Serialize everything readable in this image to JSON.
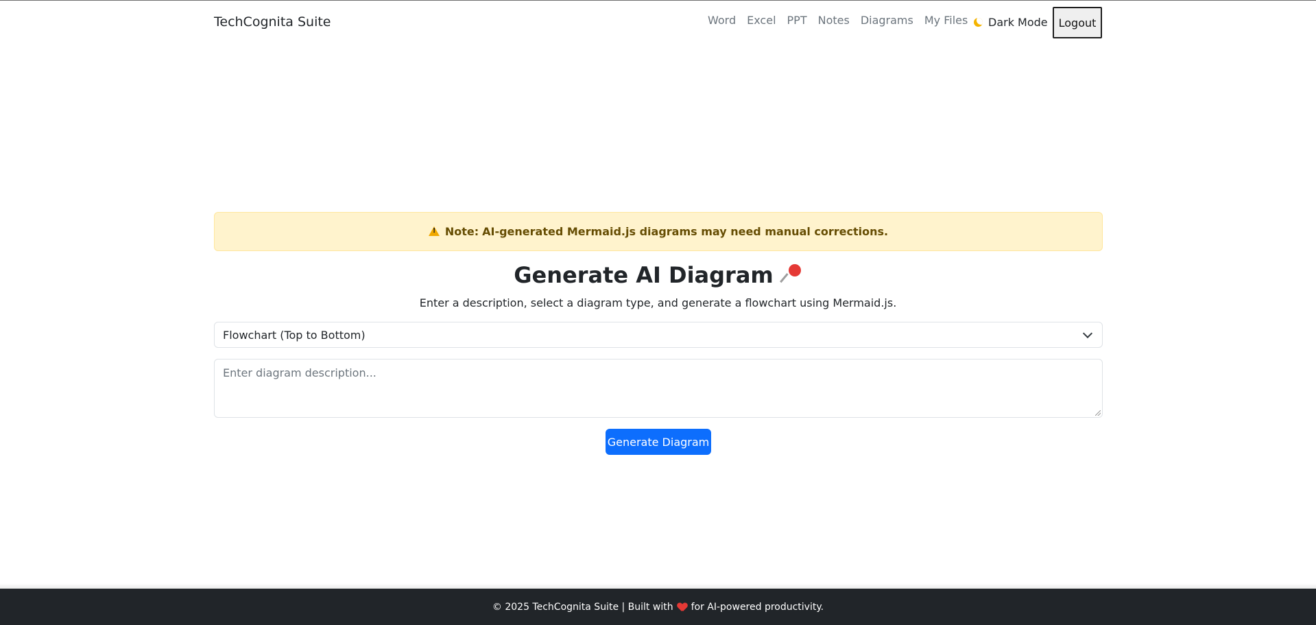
{
  "navbar": {
    "brand": "TechCognita Suite",
    "links": [
      {
        "label": "Word"
      },
      {
        "label": "Excel"
      },
      {
        "label": "PPT"
      },
      {
        "label": "Notes"
      },
      {
        "label": "Diagrams"
      },
      {
        "label": "My Files"
      }
    ],
    "dark_mode_label": "Dark Mode",
    "dark_mode_icon": "moon-icon",
    "logout_label": "Logout"
  },
  "alert": {
    "icon": "warning-icon",
    "label": "Note:",
    "message": "AI-generated Mermaid.js diagrams may need manual corrections."
  },
  "main": {
    "title": "Generate AI Diagram",
    "title_icon": "pushpin-icon",
    "subtitle": "Enter a description, select a diagram type, and generate a flowchart using Mermaid.js.",
    "diagram_type_selected": "Flowchart (Top to Bottom)",
    "description_placeholder": "Enter diagram description...",
    "generate_button": "Generate Diagram"
  },
  "footer": {
    "text_before": "© 2025 TechCognita Suite | Built with",
    "heart_icon": "heart-icon",
    "text_after": "for AI-powered productivity."
  },
  "colors": {
    "primary": "#0d6efd",
    "alert_bg": "#fff3cd",
    "alert_text": "#664d03",
    "footer_bg": "#212529"
  }
}
